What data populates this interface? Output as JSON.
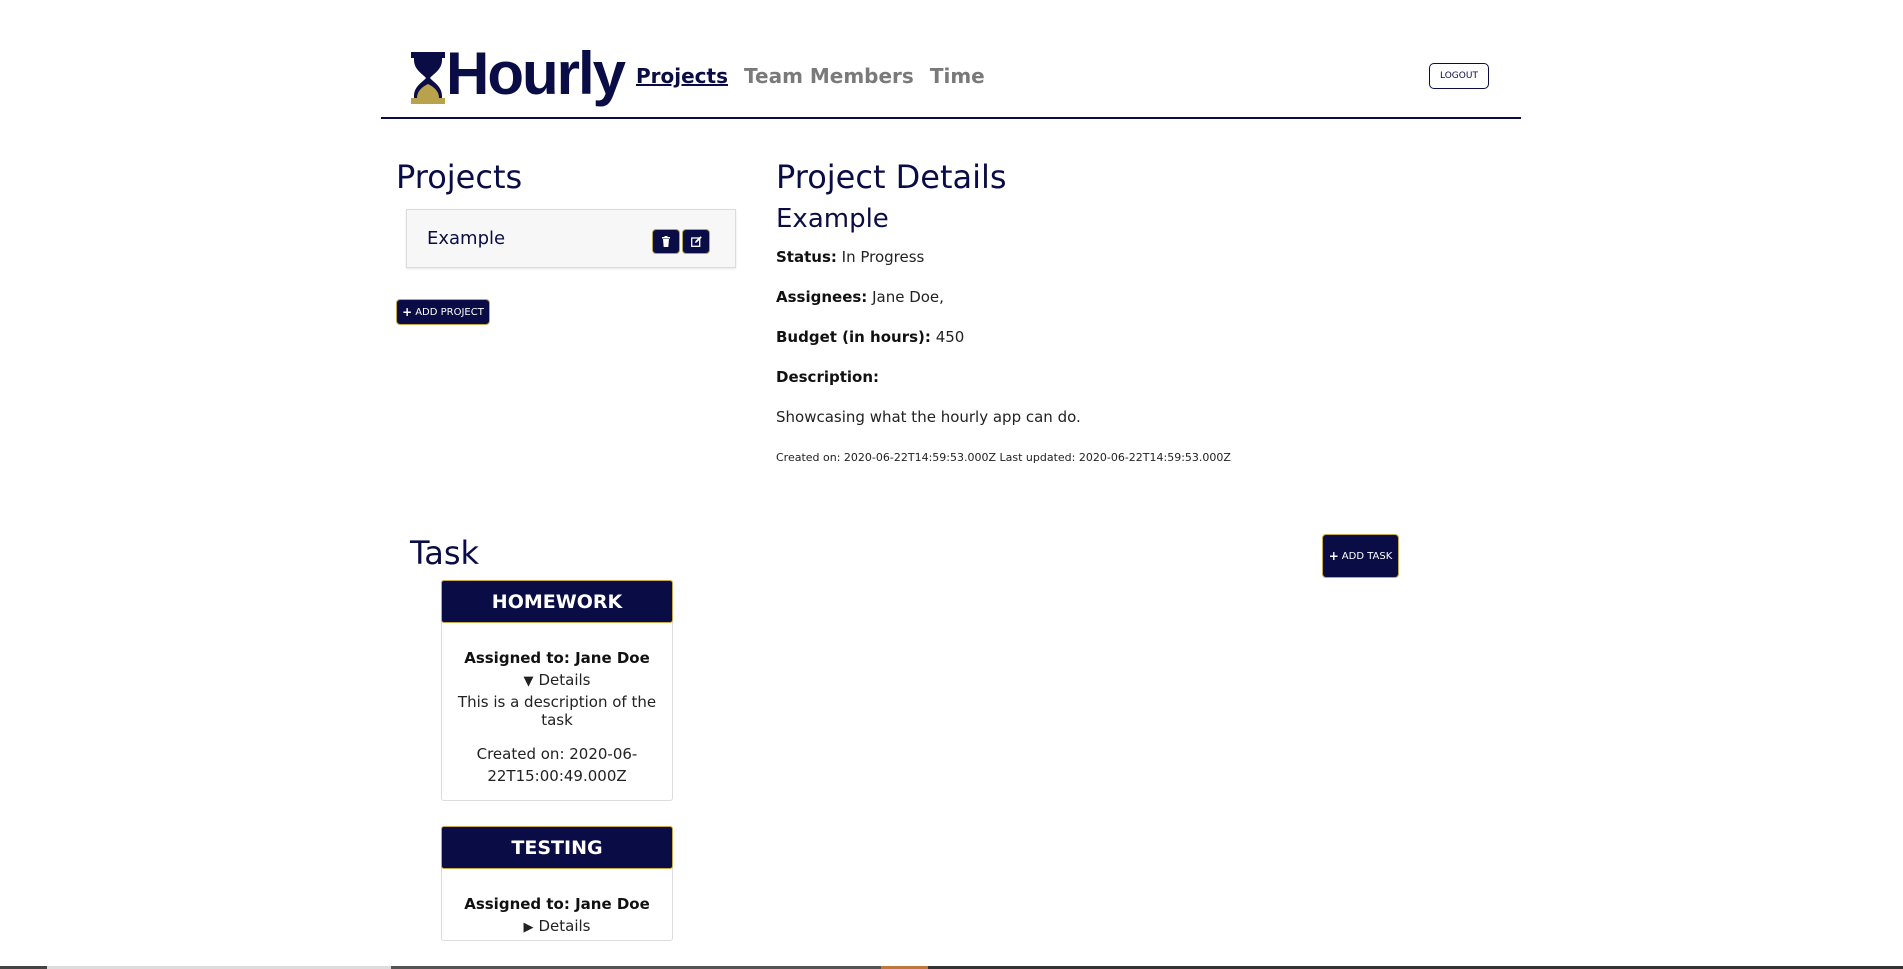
{
  "brand": {
    "name": "Hourly",
    "accent": "#0a0c45",
    "gold": "#b9a24c"
  },
  "nav": {
    "items": [
      {
        "label": "Projects",
        "active": true
      },
      {
        "label": "Team Members",
        "active": false
      },
      {
        "label": "Time",
        "active": false
      }
    ],
    "logout_label": "LOGOUT"
  },
  "projects": {
    "heading": "Projects",
    "items": [
      {
        "name": "Example"
      }
    ],
    "add_label": "ADD PROJECT"
  },
  "details": {
    "heading": "Project Details",
    "project_name": "Example",
    "status_label": "Status:",
    "status_value": "In Progress",
    "assignees_label": "Assignees:",
    "assignees_value": "Jane Doe,",
    "budget_label": "Budget (in hours):",
    "budget_value": "450",
    "description_label": "Description:",
    "description_value": "Showcasing what the hourly app can do.",
    "meta": "Created on: 2020-06-22T14:59:53.000Z Last updated: 2020-06-22T14:59:53.000Z"
  },
  "tasks": {
    "heading": "Task",
    "add_label": "ADD TASK",
    "items": [
      {
        "title": "HOMEWORK",
        "assigned": "Assigned to: Jane Doe",
        "details_label": "Details",
        "expanded": true,
        "description": "This is a description of the task",
        "created_line1": "Created on: 2020-06-",
        "created_line2": "22T15:00:49.000Z"
      },
      {
        "title": "TESTING",
        "assigned": "Assigned to: Jane Doe",
        "details_label": "Details",
        "expanded": false
      }
    ]
  }
}
